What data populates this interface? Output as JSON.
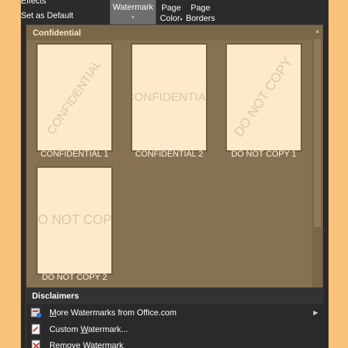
{
  "ribbon": {
    "effects_label": "Effects",
    "set_default_label": "Set as Default",
    "watermark_label": "Watermark",
    "watermark_arrow": "▾",
    "page_color_line1": "Page",
    "page_color_line2": "Color",
    "page_color_arrow": "▾",
    "page_borders_line1": "Page",
    "page_borders_line2": "Borders"
  },
  "gallery": {
    "category": "Confidential",
    "items": [
      {
        "label": "CONFIDENTIAL 1",
        "watermark": "CONFIDENTIAL",
        "orientation": "diagonal"
      },
      {
        "label": "CONFIDENTIAL 2",
        "watermark": "CONFIDENTIAL",
        "orientation": "horizontal"
      },
      {
        "label": "DO NOT COPY 1",
        "watermark": "DO NOT COPY",
        "orientation": "diagonal"
      },
      {
        "label": "DO NOT COPY 2",
        "watermark": "DO NOT COPY",
        "orientation": "horizontal"
      }
    ],
    "next_category": "Disclaimers"
  },
  "menu": {
    "more_watermarks": {
      "pre": "",
      "underline": "M",
      "post": "ore Watermarks from Office.com",
      "icon": "office-web-icon"
    },
    "custom_watermark": {
      "pre": "Custom ",
      "underline": "W",
      "post": "atermark...",
      "icon": "custom-watermark-icon"
    },
    "remove_watermark": {
      "pre": "",
      "underline": "R",
      "post": "emove Watermark",
      "icon": "remove-watermark-icon"
    },
    "submenu_arrow": "▶"
  },
  "colors": {
    "gallery_bg": "#867253",
    "thumb_bg": "#feeacb",
    "watermark_text": "#d7c7ab",
    "menu_bg": "#2a2a2a",
    "selected_button_bg": "#6e6e6e"
  }
}
